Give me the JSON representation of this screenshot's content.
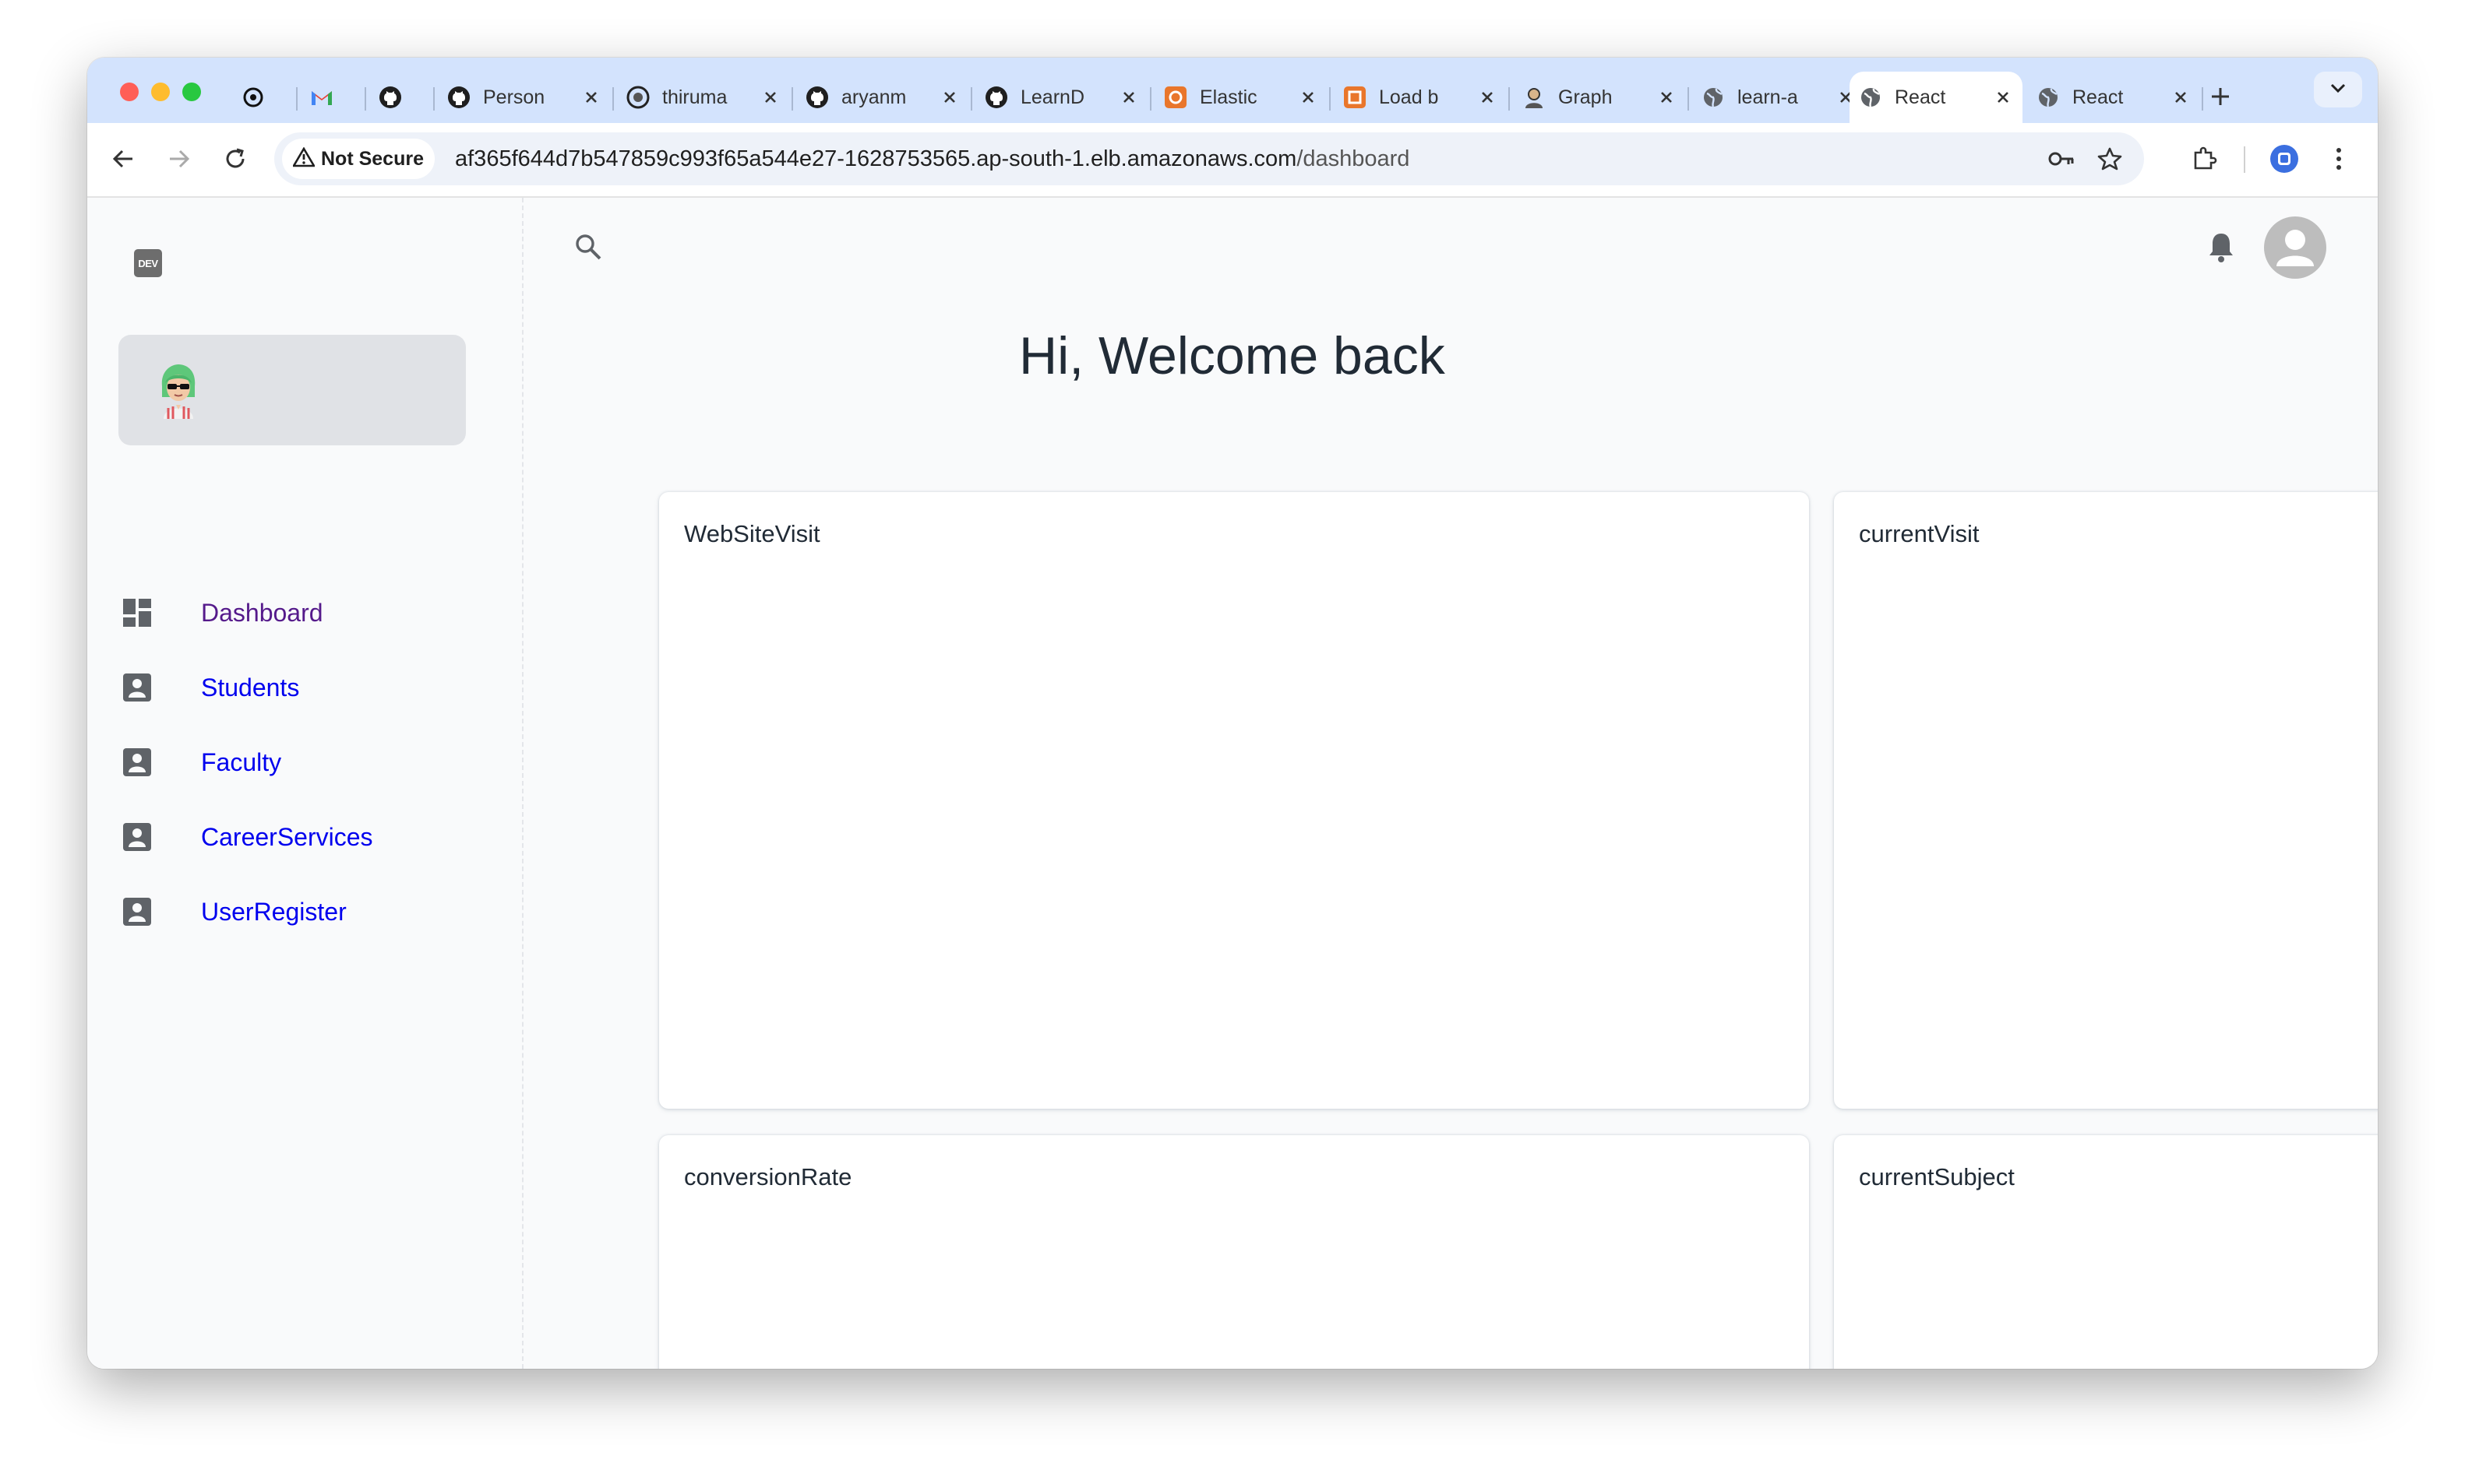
{
  "browser": {
    "tabs": [
      {
        "label": "",
        "icon": "openai-icon",
        "close": false
      },
      {
        "label": "",
        "icon": "gmail-icon",
        "close": false
      },
      {
        "label": "",
        "icon": "github-icon",
        "close": false
      },
      {
        "label": "Person",
        "icon": "github-icon",
        "close": true
      },
      {
        "label": "thiruma",
        "icon": "github-avatar-icon",
        "close": true
      },
      {
        "label": "aryanm",
        "icon": "github-icon",
        "close": true
      },
      {
        "label": "LearnD",
        "icon": "github-icon",
        "close": true
      },
      {
        "label": "Elastic",
        "icon": "aws-service-icon",
        "close": true
      },
      {
        "label": "Load b",
        "icon": "aws-service-icon",
        "close": true
      },
      {
        "label": "Graph",
        "icon": "avatar-icon",
        "close": true
      },
      {
        "label": "learn-a",
        "icon": "globe-icon",
        "close": true
      },
      {
        "label": "React",
        "icon": "globe-icon",
        "close": true,
        "active": true
      },
      {
        "label": "React",
        "icon": "globe-icon",
        "close": true
      }
    ],
    "security_label": "Not Secure",
    "url_host": "af365f644d7b547859c993f65a544e27-1628753565.ap-south-1.elb.amazonaws.com",
    "url_path": "/dashboard"
  },
  "app": {
    "logo_text": "DEV",
    "nav": [
      {
        "label": "Dashboard",
        "icon": "dashboard-icon"
      },
      {
        "label": "Students",
        "icon": "account-box-icon"
      },
      {
        "label": "Faculty",
        "icon": "account-box-icon"
      },
      {
        "label": "CareerServices",
        "icon": "account-box-icon"
      },
      {
        "label": "UserRegister",
        "icon": "account-box-icon"
      }
    ],
    "title": "Hi, Welcome back",
    "cards": [
      "WebSiteVisit",
      "currentVisit",
      "conversionRate",
      "currentSubject"
    ]
  },
  "colors": {
    "tabstrip": "#d3e3fd",
    "link": "#0000ee",
    "visited_link": "#551a8b",
    "account_box": "#e0e2e6"
  }
}
